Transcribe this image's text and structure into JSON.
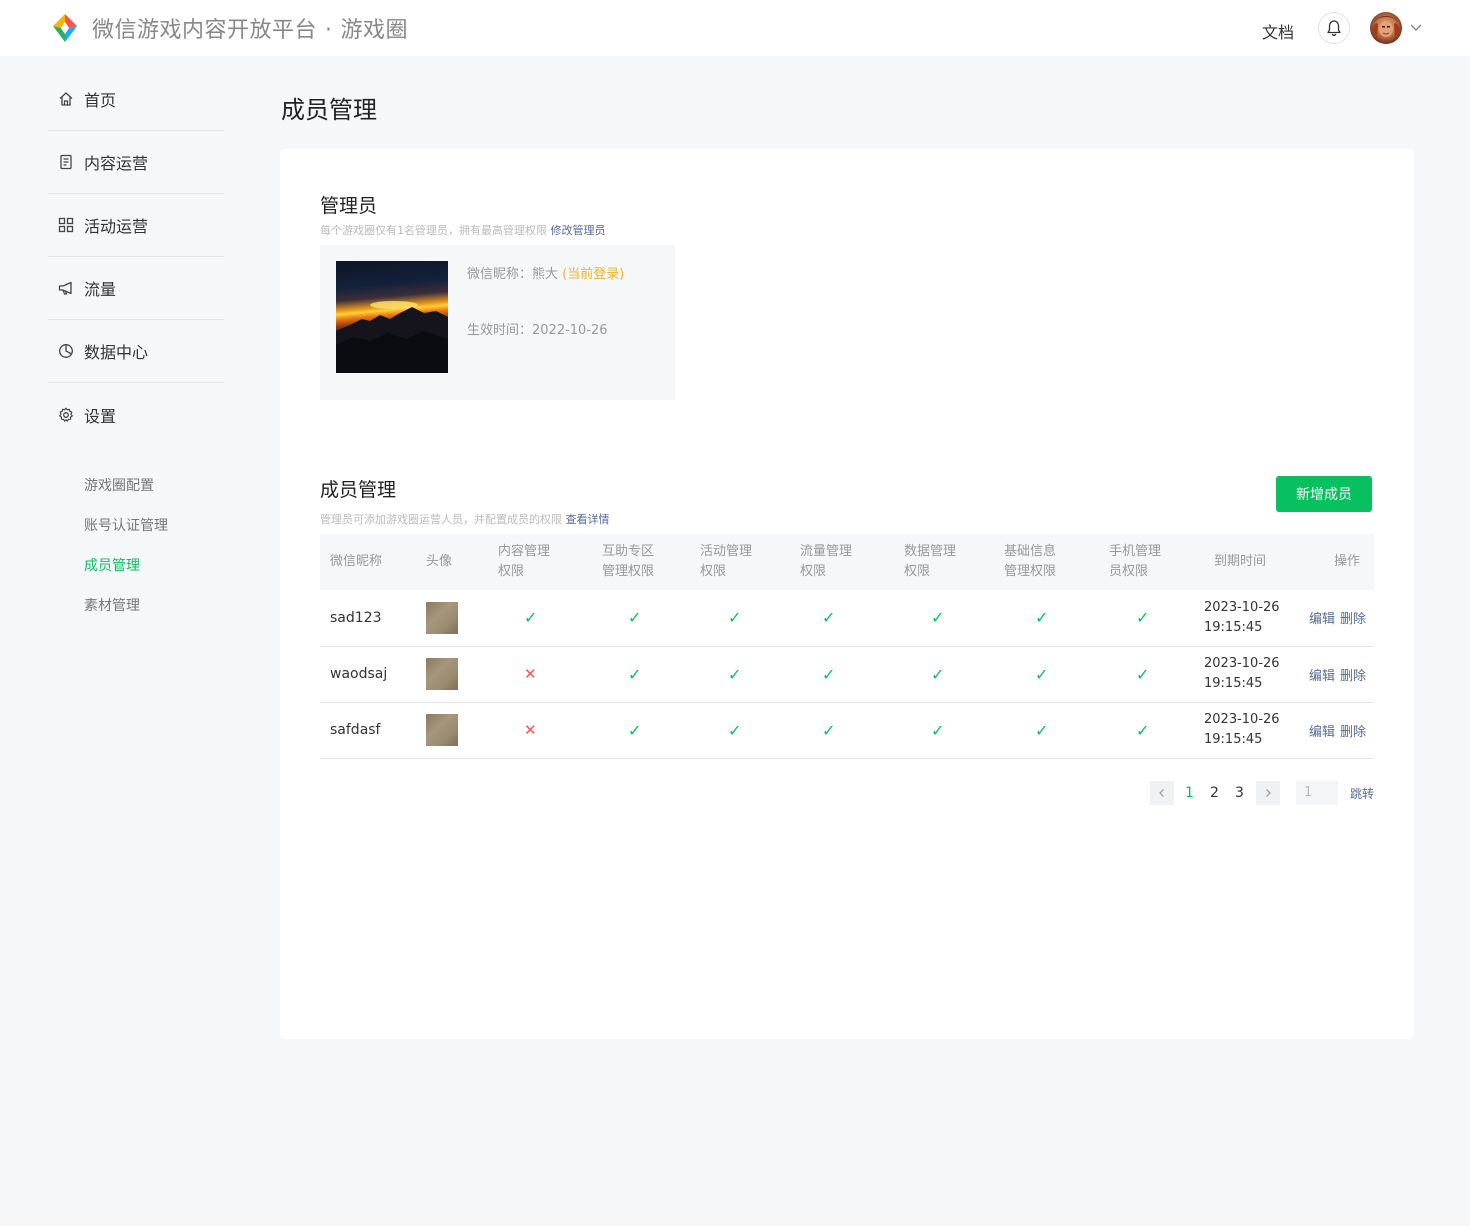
{
  "app": {
    "brand_title": "微信游戏内容开放平台",
    "brand_dot": "·",
    "brand_sub": "游戏圈",
    "docs_label": "文档"
  },
  "sidebar": {
    "items": [
      {
        "label": "首页",
        "icon": "home-icon"
      },
      {
        "label": "内容运营",
        "icon": "document-icon"
      },
      {
        "label": "活动运营",
        "icon": "grid-icon"
      },
      {
        "label": "流量",
        "icon": "megaphone-icon"
      },
      {
        "label": "数据中心",
        "icon": "pie-chart-icon"
      },
      {
        "label": "设置",
        "icon": "gear-icon"
      }
    ],
    "subitems": [
      {
        "label": "游戏圈配置"
      },
      {
        "label": "账号认证管理"
      },
      {
        "label": "成员管理",
        "active": true
      },
      {
        "label": "素材管理"
      }
    ]
  },
  "page": {
    "title": "成员管理"
  },
  "admin": {
    "title": "管理员",
    "desc": "每个游戏圈仅有1名管理员，拥有最高管理权限",
    "desc_link": "修改管理员",
    "nickname_label": "微信昵称：",
    "nickname": "熊大",
    "current_tag": "(当前登录)",
    "effective_label": "生效时间：",
    "effective_date": "2022-10-26"
  },
  "members": {
    "title": "成员管理",
    "desc": "管理员可添加游戏圈运营人员，并配置成员的权限",
    "desc_link": "查看详情",
    "add_button": "新增成员",
    "columns": [
      "微信昵称",
      "头像",
      "内容管理\n权限",
      "互助专区\n管理权限",
      "活动管理\n权限",
      "流量管理\n权限",
      "数据管理\n权限",
      "基础信息\n管理权限",
      "手机管理\n员权限",
      "到期时间",
      "操作"
    ],
    "rows": [
      {
        "nickname": "sad123",
        "perms": [
          true,
          true,
          true,
          true,
          true,
          true,
          true
        ],
        "expire_date": "2023-10-26",
        "expire_time": "19:15:45"
      },
      {
        "nickname": "waodsaj",
        "perms": [
          false,
          true,
          true,
          true,
          true,
          true,
          true
        ],
        "expire_date": "2023-10-26",
        "expire_time": "19:15:45"
      },
      {
        "nickname": "safdasf",
        "perms": [
          false,
          true,
          true,
          true,
          true,
          true,
          true
        ],
        "expire_date": "2023-10-26",
        "expire_time": "19:15:45"
      }
    ],
    "edit_label": "编辑",
    "delete_label": "删除",
    "check_glyph": "✓",
    "cross_glyph": "✕"
  },
  "pagination": {
    "pages": [
      "1",
      "2",
      "3"
    ],
    "current": "1",
    "jump_value": "1",
    "jump_label": "跳转"
  },
  "colors": {
    "accent": "#07c160",
    "link": "#576b95",
    "warning": "#f0b429",
    "danger": "#fa5151"
  }
}
